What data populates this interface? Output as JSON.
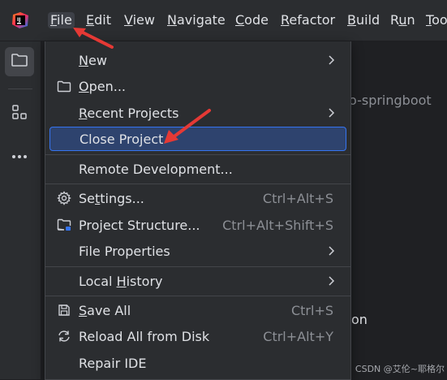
{
  "menubar": {
    "items": [
      {
        "label": "File",
        "mnemonic": "F",
        "rest": "ile"
      },
      {
        "label": "Edit",
        "mnemonic": "E",
        "rest": "dit"
      },
      {
        "label": "View",
        "mnemonic": "V",
        "rest": "iew"
      },
      {
        "label": "Navigate",
        "mnemonic": "N",
        "rest": "avigate"
      },
      {
        "label": "Code",
        "mnemonic": "C",
        "rest": "ode"
      },
      {
        "label": "Refactor",
        "mnemonic": "R",
        "rest": "efactor"
      },
      {
        "label": "Build",
        "mnemonic": "B",
        "rest": "uild"
      },
      {
        "label": "Run",
        "mnemonic": "u",
        "pre": "R",
        "rest": "n"
      },
      {
        "label": "Too",
        "mnemonic": "T",
        "rest": "oo"
      }
    ],
    "active": "File"
  },
  "background": {
    "project_fragment": "o-springboot",
    "text_fragment": "on"
  },
  "file_menu": {
    "items": [
      {
        "label": "New",
        "mnemonic": "N",
        "submenu": true
      },
      {
        "label": "Open...",
        "mnemonic": "O",
        "icon": "folder-icon"
      },
      {
        "label": "Recent Projects",
        "mnemonic": "R",
        "submenu": true
      },
      {
        "label": "Close Project",
        "highlighted": true
      },
      {
        "label": "Remote Development..."
      },
      {
        "label": "Settings...",
        "mnemonic": "t",
        "icon": "gear-icon",
        "shortcut": "Ctrl+Alt+S"
      },
      {
        "label": "Project Structure...",
        "icon": "project-structure-icon",
        "shortcut": "Ctrl+Alt+Shift+S"
      },
      {
        "label": "File Properties",
        "submenu": true
      },
      {
        "label": "Local History",
        "mnemonic": "H",
        "submenu": true
      },
      {
        "label": "Save All",
        "mnemonic": "S",
        "icon": "save-icon",
        "shortcut": "Ctrl+S"
      },
      {
        "label": "Reload All from Disk",
        "icon": "reload-icon",
        "shortcut": "Ctrl+Alt+Y"
      },
      {
        "label": "Repair IDE"
      }
    ]
  },
  "watermark": "CSDN @艾伦~耶格尔",
  "colors": {
    "menubar_bg": "#2b2d30",
    "highlight_bg": "#2e436e",
    "highlight_border": "#3574f0",
    "annotation_arrow": "#e53935"
  }
}
